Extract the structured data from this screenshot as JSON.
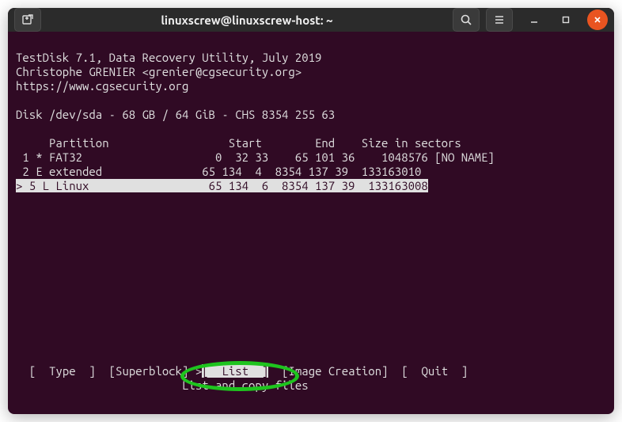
{
  "window": {
    "title": "linuxscrew@linuxscrew-host: ~"
  },
  "header": {
    "line1": "TestDisk 7.1, Data Recovery Utility, July 2019",
    "line2": "Christophe GRENIER <grenier@cgsecurity.org>",
    "line3": "https://www.cgsecurity.org"
  },
  "disk_line": "Disk /dev/sda - 68 GB / 64 GiB - CHS 8354 255 63",
  "table_header": "     Partition                  Start        End    Size in sectors",
  "partitions": [
    " 1 * FAT32                    0  32 33    65 101 36    1048576 [NO NAME]",
    " 2 E extended               65 134  4  8354 137 39  133163010",
    "> 5 L Linux                  65 134  6  8354 137 39  133163008"
  ],
  "menu": {
    "type": "[  Type  ]",
    "superblock": "[Superblock]",
    "list_prefix": ">",
    "list": "[  List  ]",
    "image": "[Image Creation]",
    "quit": "[  Quit  ]",
    "hint": "List and copy files"
  }
}
